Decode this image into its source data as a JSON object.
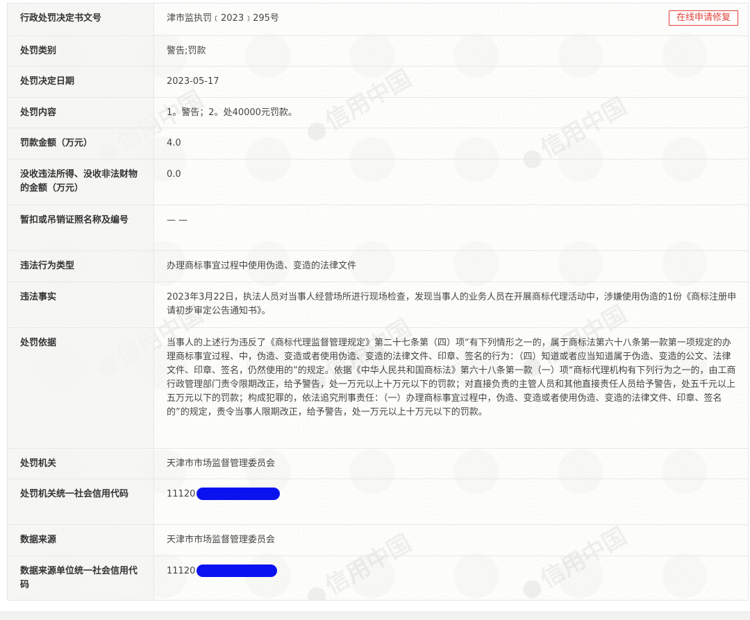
{
  "watermark": "信用中国",
  "repair_button": "在线申请修复",
  "rows": [
    {
      "label": "行政处罚决定书文号",
      "value": "津市监执罚﹝2023﹞295号"
    },
    {
      "label": "处罚类别",
      "value": "警告;罚款"
    },
    {
      "label": "处罚决定日期",
      "value": "2023-05-17"
    },
    {
      "label": "处罚内容",
      "value": "1。警告；2。处40000元罚款。"
    },
    {
      "label": "罚款金额（万元）",
      "value": "4.0"
    },
    {
      "label": "没收违法所得、没收非法财物的金额（万元）",
      "value": "0.0"
    },
    {
      "label": "暂扣或吊销证照名称及编号",
      "value": "— —"
    },
    {
      "label": "违法行为类型",
      "value": "办理商标事宜过程中使用伪造、变造的法律文件"
    },
    {
      "label": "违法事实",
      "value": "2023年3月22日，执法人员对当事人经营场所进行现场检查，发现当事人的业务人员在开展商标代理活动中，涉嫌使用伪造的1份《商标注册申请初步审定公告通知书》。"
    },
    {
      "label": "处罚依据",
      "value": "当事人的上述行为违反了《商标代理监督管理规定》第二十七条第（四）项“有下列情形之一的，属于商标法第六十八条第一款第一项规定的办理商标事宜过程、中，伪造、变造或者使用伪造、变造的法律文件、印章、签名的行为：（四）知道或者应当知道属于伪造、变造的公文、法律文件、印章、签名，仍然使用的”的规定。依据《中华人民共和国商标法》第六十八条第一款（一）项“商标代理机构有下列行为之一的，由工商行政管理部门责令限期改正，给予警告，处一万元以上十万元以下的罚款；对直接负责的主管人员和其他直接责任人员给予警告，处五千元以上五万元以下的罚款；构成犯罪的，依法追究刑事责任：（一）办理商标事宜过程中，伪造、变造或者使用伪造、变造的法律文件、印章、签名的”的规定，责令当事人限期改正，给予警告，处一万元以上十万元以下的罚款。"
    },
    {
      "label": "处罚机关",
      "value": "天津市市场监督管理委员会"
    },
    {
      "label": "处罚机关统一社会信用代码",
      "value": "11120"
    },
    {
      "label": "数据来源",
      "value": "天津市市场监督管理委员会"
    },
    {
      "label": "数据来源单位统一社会信用代码",
      "value": "11120"
    }
  ]
}
